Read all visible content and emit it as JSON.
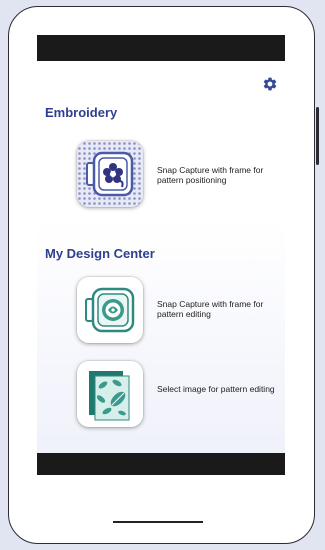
{
  "header": {
    "settings_icon": "gear-icon"
  },
  "sections": [
    {
      "title": "Embroidery",
      "items": [
        {
          "icon": "embroidery-frame-icon",
          "label": "Snap Capture with frame for pattern positioning"
        }
      ]
    },
    {
      "title": "My Design Center",
      "items": [
        {
          "icon": "design-frame-icon",
          "label": "Snap Capture with frame for pattern editing"
        },
        {
          "icon": "image-leaves-icon",
          "label": "Select image for pattern editing"
        }
      ]
    }
  ],
  "colors": {
    "accent": "#2f3f90",
    "gear": "#344a96",
    "frame": "#4a5aa8",
    "teal": "#3a9a8c",
    "page_background": "#e1e4f1"
  }
}
